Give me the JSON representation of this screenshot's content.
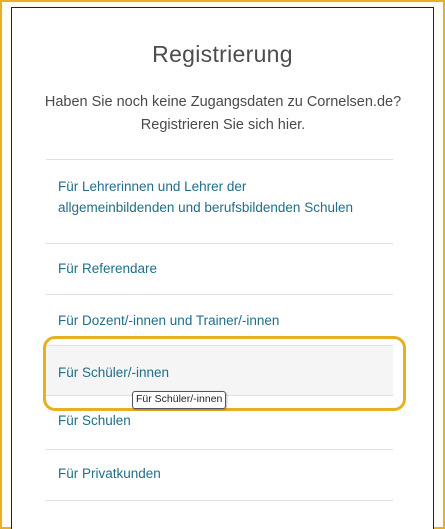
{
  "registration": {
    "title": "Registrierung",
    "subtitle_line1": "Haben Sie noch keine Zugangsdaten zu Cornelsen.de?",
    "subtitle_line2": "Registrieren Sie sich hier."
  },
  "options": [
    {
      "line1": "Für Lehrerinnen und Lehrer der",
      "line2": "allgemeinbildenden und berufsbildenden Schulen"
    },
    {
      "label": "Für Referendare"
    },
    {
      "label": "Für Dozent/-innen und Trainer/-innen"
    },
    {
      "label": "Für Schüler/-innen"
    },
    {
      "label": "Für Schulen"
    },
    {
      "label": "Für Privatkunden"
    }
  ],
  "tooltip": "Für Schüler/-innen",
  "colors": {
    "link": "#1f6e8a",
    "highlight": "#e8b020"
  }
}
